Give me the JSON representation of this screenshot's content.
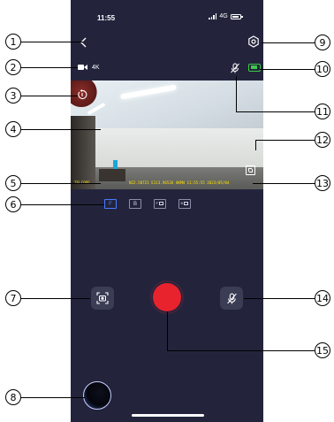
{
  "status_bar": {
    "time": "11:55",
    "network": "4G"
  },
  "header": {
    "back_icon": "chevron-left-icon",
    "settings_icon": "gear-icon"
  },
  "camera_info": {
    "camera_icon": "video-camera-icon",
    "resolution": "4K"
  },
  "indicators": {
    "mic_icon": "mic-off-icon",
    "battery_color": "#3ecb4a"
  },
  "video": {
    "osd_left": "TELCODE",
    "osd_right": "N22.58721 E113.96526 0KMH 11:55:55 2023/05/04"
  },
  "view_tabs": [
    {
      "label": "F",
      "active": true
    },
    {
      "label": "B",
      "active": false
    },
    {
      "label": "F",
      "active": false,
      "pip": true
    },
    {
      "label": "B",
      "active": false,
      "pip": true
    }
  ],
  "controls": {
    "snapshot_icon": "camera-snapshot-icon",
    "record_color": "#e8232e",
    "mic_icon": "mic-off-icon"
  },
  "callouts": [
    "1",
    "2",
    "3",
    "4",
    "5",
    "6",
    "7",
    "8",
    "9",
    "10",
    "11",
    "12",
    "13",
    "14",
    "15"
  ],
  "accent_color": "#4a7cff",
  "background_color": "#23243c"
}
